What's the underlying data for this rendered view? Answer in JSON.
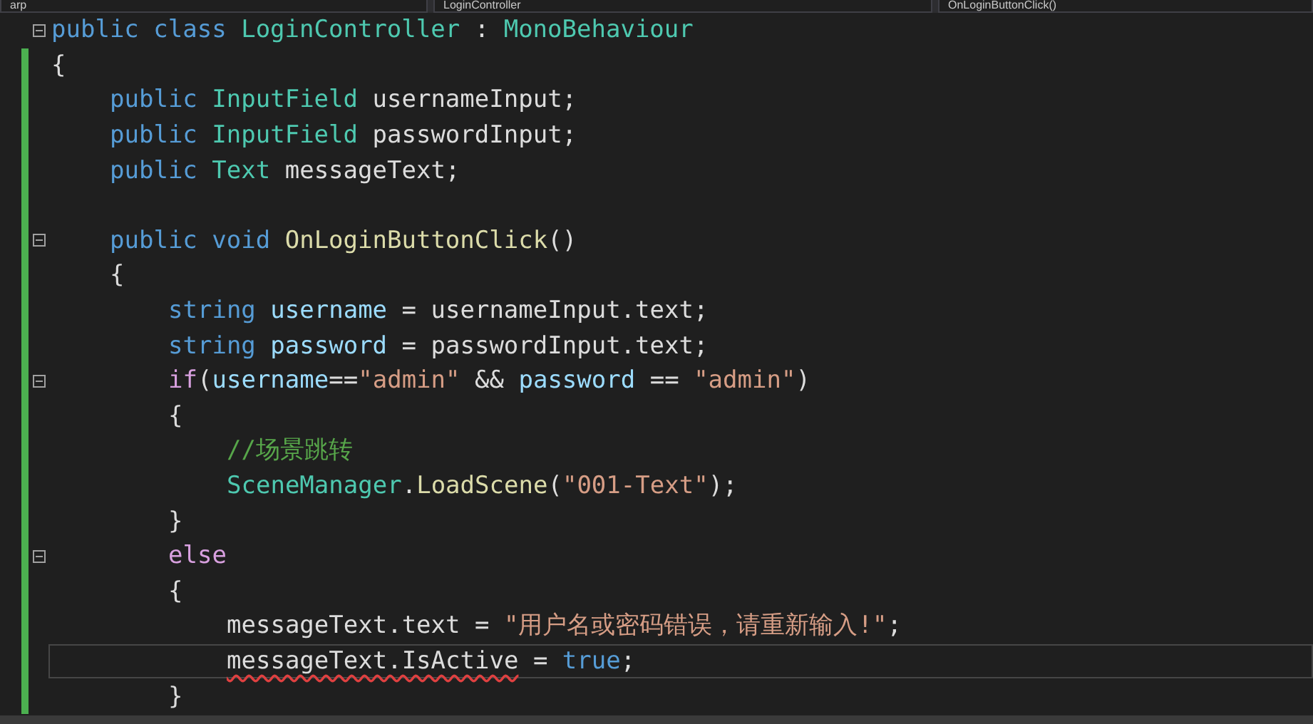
{
  "navigation_bar": {
    "dropdowns": [
      {
        "text": "arp"
      },
      {
        "text": "LoginController"
      },
      {
        "text": "OnLoginButtonClick()"
      }
    ]
  },
  "editor": {
    "lines": [
      {
        "foldable": true,
        "changed": false,
        "current": false,
        "tokens": [
          {
            "kind": "keyword",
            "text": "public "
          },
          {
            "kind": "keyword",
            "text": "class "
          },
          {
            "kind": "type",
            "text": "LoginController"
          },
          {
            "kind": "plain",
            "text": " : "
          },
          {
            "kind": "type",
            "text": "MonoBehaviour"
          }
        ]
      },
      {
        "foldable": false,
        "changed": true,
        "current": false,
        "tokens": [
          {
            "kind": "plain",
            "text": "{"
          }
        ],
        "children": [
          {
            "foldable": false,
            "changed": true,
            "current": false,
            "tokens": [
              {
                "kind": "keyword",
                "text": "public "
              },
              {
                "kind": "type",
                "text": "InputField"
              },
              {
                "kind": "plain",
                "text": " usernameInput;"
              }
            ]
          },
          {
            "foldable": false,
            "changed": true,
            "current": false,
            "tokens": [
              {
                "kind": "keyword",
                "text": "public "
              },
              {
                "kind": "type",
                "text": "InputField"
              },
              {
                "kind": "plain",
                "text": " passwordInput;"
              }
            ]
          },
          {
            "foldable": false,
            "changed": true,
            "current": false,
            "tokens": [
              {
                "kind": "keyword",
                "text": "public "
              },
              {
                "kind": "type",
                "text": "Text"
              },
              {
                "kind": "plain",
                "text": " messageText;"
              }
            ]
          },
          {
            "foldable": false,
            "changed": true,
            "current": false
          },
          {
            "foldable": true,
            "changed": true,
            "current": false,
            "tokens": [
              {
                "kind": "keyword",
                "text": "public "
              },
              {
                "kind": "keyword",
                "text": "void "
              },
              {
                "kind": "method",
                "text": "OnLoginButtonClick"
              },
              {
                "kind": "plain",
                "text": "()"
              }
            ]
          },
          {
            "foldable": false,
            "changed": true,
            "current": false,
            "tokens": [
              {
                "kind": "plain",
                "text": "{"
              }
            ],
            "children": [
              {
                "foldable": false,
                "changed": true,
                "current": false,
                "tokens": [
                  {
                    "kind": "keyword",
                    "text": "string "
                  },
                  {
                    "kind": "local",
                    "text": "username"
                  },
                  {
                    "kind": "plain",
                    "text": " = usernameInput.text;"
                  }
                ]
              },
              {
                "foldable": false,
                "changed": true,
                "current": false,
                "tokens": [
                  {
                    "kind": "keyword",
                    "text": "string "
                  },
                  {
                    "kind": "local",
                    "text": "password"
                  },
                  {
                    "kind": "plain",
                    "text": " = passwordInput.text;"
                  }
                ]
              },
              {
                "foldable": true,
                "changed": true,
                "current": false,
                "tokens": [
                  {
                    "kind": "control",
                    "text": "if"
                  },
                  {
                    "kind": "plain",
                    "text": "("
                  },
                  {
                    "kind": "local",
                    "text": "username"
                  },
                  {
                    "kind": "plain",
                    "text": "=="
                  },
                  {
                    "kind": "string",
                    "text": "\"admin\""
                  },
                  {
                    "kind": "plain",
                    "text": " && "
                  },
                  {
                    "kind": "local",
                    "text": "password"
                  },
                  {
                    "kind": "plain",
                    "text": " == "
                  },
                  {
                    "kind": "string",
                    "text": "\"admin\""
                  },
                  {
                    "kind": "plain",
                    "text": ")"
                  }
                ]
              },
              {
                "foldable": false,
                "changed": true,
                "current": false,
                "tokens": [
                  {
                    "kind": "plain",
                    "text": "{"
                  }
                ],
                "children": [
                  {
                    "foldable": false,
                    "changed": true,
                    "current": false,
                    "tokens": [
                      {
                        "kind": "comment",
                        "text": "//场景跳转"
                      }
                    ]
                  },
                  {
                    "foldable": false,
                    "changed": true,
                    "current": false,
                    "tokens": [
                      {
                        "kind": "type",
                        "text": "SceneManager"
                      },
                      {
                        "kind": "plain",
                        "text": "."
                      },
                      {
                        "kind": "method",
                        "text": "LoadScene"
                      },
                      {
                        "kind": "plain",
                        "text": "("
                      },
                      {
                        "kind": "string",
                        "text": "\"001-Text\""
                      },
                      {
                        "kind": "plain",
                        "text": ");"
                      }
                    ]
                  }
                ]
              },
              {
                "foldable": false,
                "changed": true,
                "current": false,
                "tokens": [
                  {
                    "kind": "plain",
                    "text": "}"
                  }
                ]
              },
              {
                "foldable": true,
                "changed": true,
                "current": false,
                "tokens": [
                  {
                    "kind": "control",
                    "text": "else"
                  }
                ]
              },
              {
                "foldable": false,
                "changed": true,
                "current": false,
                "tokens": [
                  {
                    "kind": "plain",
                    "text": "{"
                  }
                ],
                "children": [
                  {
                    "foldable": false,
                    "changed": true,
                    "current": false,
                    "tokens": [
                      {
                        "kind": "plain",
                        "text": "messageText.text = "
                      },
                      {
                        "kind": "string",
                        "text": "\"用户名或密码错误，请重新输入!\""
                      },
                      {
                        "kind": "plain",
                        "text": ";"
                      }
                    ]
                  },
                  {
                    "foldable": false,
                    "changed": true,
                    "current": true,
                    "tokens": [
                      {
                        "kind": "plain",
                        "text": "messageText.IsActive",
                        "error": true
                      },
                      {
                        "kind": "plain",
                        "text": " = "
                      },
                      {
                        "kind": "keyword",
                        "text": "true"
                      },
                      {
                        "kind": "plain",
                        "text": ";"
                      }
                    ]
                  }
                ]
              },
              {
                "foldable": false,
                "changed": true,
                "current": false,
                "tokens": [
                  {
                    "kind": "plain",
                    "text": "}"
                  }
                ]
              }
            ]
          }
        ]
      }
    ]
  }
}
